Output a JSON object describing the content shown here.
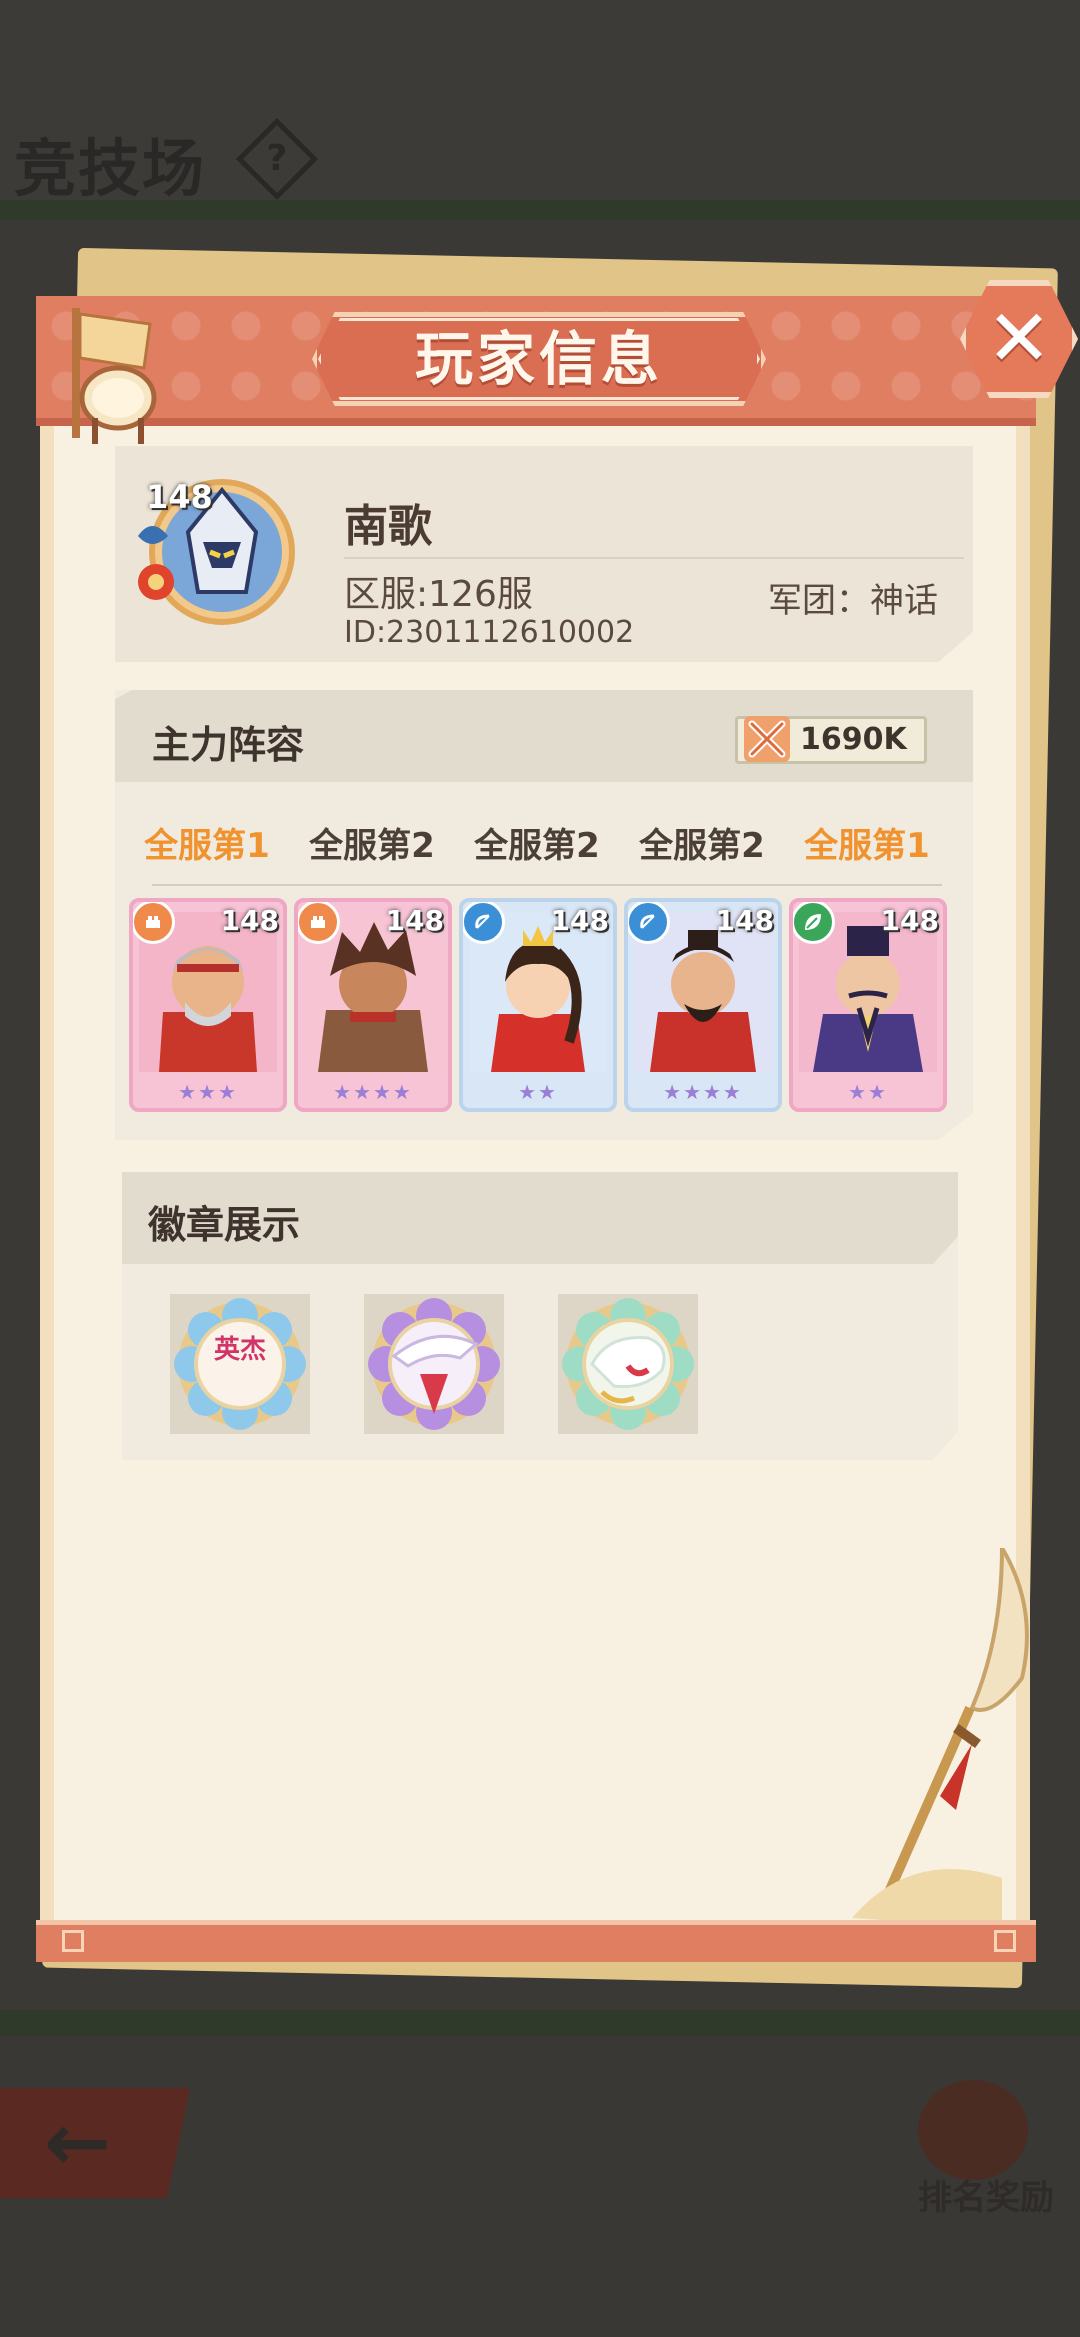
{
  "background": {
    "screen_title": "竞技场",
    "help_symbol": "?",
    "reward_label": "排名奖励"
  },
  "dialog": {
    "title": "玩家信息",
    "close_symbol": "✕"
  },
  "player": {
    "level": "148",
    "name": "南歌",
    "server": "区服:126服",
    "guild": "军团：神话",
    "id": "ID:2301112610002"
  },
  "team": {
    "title": "主力阵容",
    "power": "1690K",
    "ranks": [
      {
        "text": "全服第1",
        "color": "#f0922e"
      },
      {
        "text": "全服第2",
        "color": "#4b3f37"
      },
      {
        "text": "全服第2",
        "color": "#4b3f37"
      },
      {
        "text": "全服第2",
        "color": "#4b3f37"
      },
      {
        "text": "全服第1",
        "color": "#f0922e"
      }
    ],
    "heroes": [
      {
        "level": "148",
        "stars": "★★★",
        "badge_icon": "fist-icon",
        "badge_color": "#f08a4a",
        "frame": "pink"
      },
      {
        "level": "148",
        "stars": "★★★★",
        "badge_icon": "fist-icon",
        "badge_color": "#f08a4a",
        "frame": "pink"
      },
      {
        "level": "148",
        "stars": "★★",
        "badge_icon": "bow-icon",
        "badge_color": "#3a8fd6",
        "frame": "blue"
      },
      {
        "level": "148",
        "stars": "★★★★",
        "badge_icon": "bow-icon",
        "badge_color": "#3a8fd6",
        "frame": "blue"
      },
      {
        "level": "148",
        "stars": "★★",
        "badge_icon": "leaf-icon",
        "badge_color": "#3aa65a",
        "frame": "pink"
      }
    ]
  },
  "badges": {
    "title": "徽章展示",
    "items": [
      {
        "icon": "hero-medal-icon",
        "text": "英杰"
      },
      {
        "icon": "dragon-medal-icon"
      },
      {
        "icon": "tiger-medal-icon"
      }
    ]
  },
  "colors": {
    "accent": "#e07e62",
    "rank_highlight": "#f0922e",
    "panel_bg": "#f8f1e2"
  }
}
